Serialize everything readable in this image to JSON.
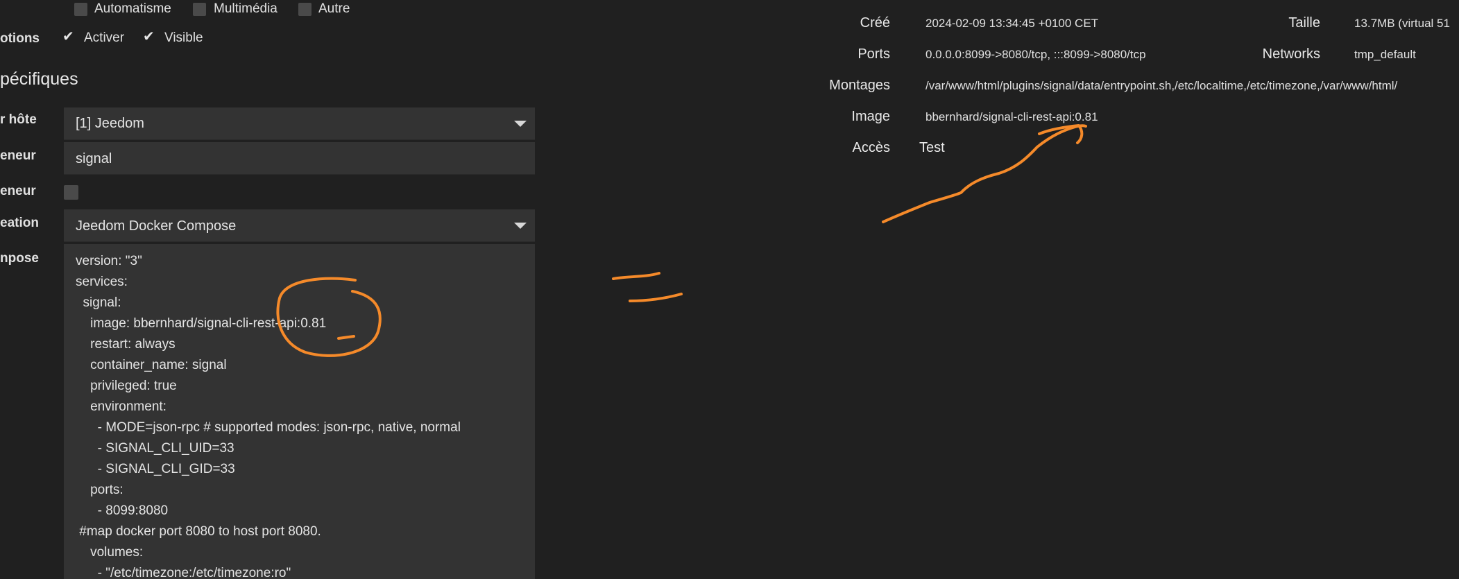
{
  "categories": {
    "items": [
      {
        "label": "Automatisme",
        "checked": false
      },
      {
        "label": "Multimédia",
        "checked": false
      },
      {
        "label": "Autre",
        "checked": false
      }
    ]
  },
  "options": {
    "label": "otions",
    "items": [
      {
        "label": "Activer",
        "checked": true
      },
      {
        "label": "Visible",
        "checked": true
      }
    ]
  },
  "section": {
    "title": "pécifiques"
  },
  "form": {
    "host_label": "r hôte",
    "host_value": "[1] Jeedom",
    "container_label": "eneur",
    "container_value": "signal",
    "container2_label": "eneur",
    "creation_label": "eation",
    "creation_value": "Jeedom Docker Compose",
    "compose_label": "npose"
  },
  "compose": {
    "lines": [
      "version: \"3\"",
      "services:",
      "  signal:",
      "    image: bbernhard/signal-cli-rest-api:0.81",
      "    restart: always",
      "    container_name: signal",
      "    privileged: true",
      "    environment:",
      "      - MODE=json-rpc # supported modes: json-rpc, native, normal",
      "      - SIGNAL_CLI_UID=33",
      "      - SIGNAL_CLI_GID=33",
      "    ports:",
      "      - 8099:8080",
      " #map docker port 8080 to host port 8080.",
      "    volumes:",
      "      - \"/etc/timezone:/etc/timezone:ro\""
    ]
  },
  "info": {
    "created_label": "Créé",
    "created_value": "2024-02-09 13:34:45 +0100 CET",
    "size_label": "Taille",
    "size_value": "13.7MB (virtual 51",
    "ports_label": "Ports",
    "ports_value": "0.0.0.0:8099->8080/tcp, :::8099->8080/tcp",
    "networks_label": "Networks",
    "networks_value": "tmp_default",
    "mounts_label": "Montages",
    "mounts_value": "/var/www/html/plugins/signal/data/entrypoint.sh,/etc/localtime,/etc/timezone,/var/www/html/",
    "image_label": "Image",
    "image_value": "bbernhard/signal-cli-rest-api:0.81",
    "access_label": "Accès",
    "access_value": "Test"
  },
  "colors": {
    "background": "#202020",
    "field": "#333333",
    "checkbox": "#4a4a4a",
    "annotation": "#f58a2a"
  }
}
